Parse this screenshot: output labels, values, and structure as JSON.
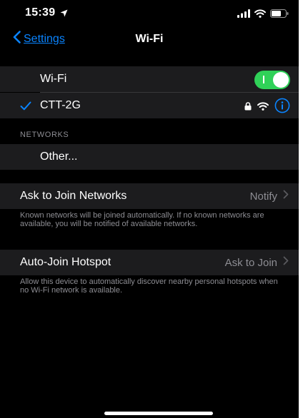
{
  "status_bar": {
    "time": "15:39",
    "icons": [
      "location-arrow-icon",
      "cellular-signal-icon",
      "wifi-icon",
      "battery-icon"
    ]
  },
  "nav": {
    "back_label": "Settings",
    "title": "Wi-Fi"
  },
  "wifi_toggle": {
    "label": "Wi-Fi",
    "on": true
  },
  "current_network": {
    "name": "CTT-2G",
    "connected": true,
    "secured": true
  },
  "networks_section": {
    "header": "NETWORKS",
    "other_label": "Other..."
  },
  "ask_to_join": {
    "label": "Ask to Join Networks",
    "value": "Notify",
    "footnote": "Known networks will be joined automatically. If no known networks are available, you will be notified of available networks."
  },
  "auto_join_hotspot": {
    "label": "Auto-Join Hotspot",
    "value": "Ask to Join",
    "footnote": "Allow this device to automatically discover nearby personal hotspots when no Wi-Fi network is available."
  },
  "colors": {
    "accent": "#0a84ff",
    "toggle_on": "#30d158",
    "cell_bg": "#1c1c1e",
    "secondary_text": "#8d8d93"
  }
}
